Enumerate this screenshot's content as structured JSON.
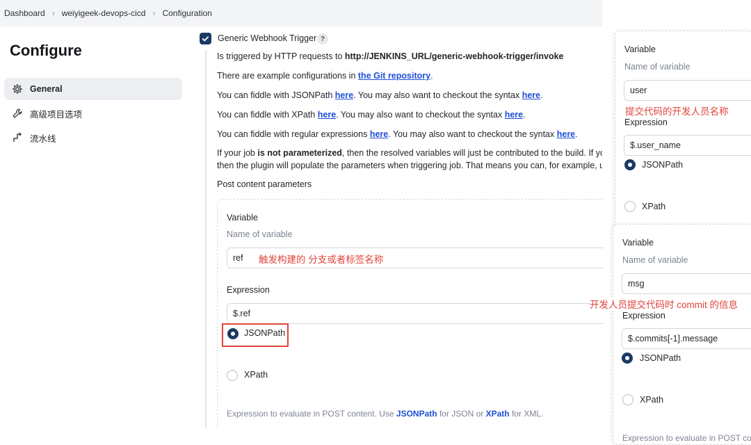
{
  "breadcrumb": {
    "items": [
      "Dashboard",
      "weiyigeek-devops-cicd",
      "Configuration"
    ]
  },
  "sidebar": {
    "title": "Configure",
    "items": [
      {
        "label": "General",
        "icon": "gear-icon"
      },
      {
        "label": "高级项目选项",
        "icon": "wrench-icon"
      },
      {
        "label": "流水线",
        "icon": "pipeline-icon"
      }
    ]
  },
  "trigger": {
    "label": "Generic Webhook Trigger",
    "help": "?",
    "p1_prefix": "Is triggered by HTTP requests to ",
    "p1_bold": "http://JENKINS_URL/generic-webhook-trigger/invoke",
    "p2_prefix": "There are example configurations in ",
    "p2_link": "the Git repository",
    "p2_suffix": ".",
    "p3_a": "You can fiddle with JSONPath ",
    "p3_link1": "here",
    "p3_b": ". You may also want to checkout the syntax ",
    "p3_link2": "here",
    "p3_c": ".",
    "p4_a": "You can fiddle with XPath ",
    "p4_link1": "here",
    "p4_b": ". You may also want to checkout the syntax ",
    "p4_link2": "here",
    "p4_c": ".",
    "p5_a": "You can fiddle with regular expressions ",
    "p5_link1": "here",
    "p5_b": ". You may also want to checkout the syntax ",
    "p5_link2": "here",
    "p5_c": ".",
    "p6_a": "If your job ",
    "p6_bold": "is not parameterized",
    "p6_b": ", then the resolved variables will just be contributed to the build. If your",
    "p7": "then the plugin will populate the parameters when triggering job. That means you can, for example, use",
    "post_params": "Post content parameters"
  },
  "main_var": {
    "variable_label": "Variable",
    "name_hint": "Name of variable",
    "name_value": "ref",
    "name_note": "触发构建的 分支或者标签名称",
    "expression_label": "Expression",
    "expression_value": "$.ref",
    "opt_jsonpath": "JSONPath",
    "opt_xpath": "XPath",
    "foot_a": "Expression to evaluate in POST content. Use ",
    "foot_link1": "JSONPath",
    "foot_b": " for JSON or ",
    "foot_link2": "XPath",
    "foot_c": " for XML."
  },
  "panel_user": {
    "variable_label": "Variable",
    "name_hint": "Name of variable",
    "name_value": "user",
    "name_note": "提交代码的开发人员名称",
    "expression_label": "Expression",
    "expression_value": "$.user_name",
    "opt_jsonpath": "JSONPath",
    "opt_xpath": "XPath"
  },
  "panel_msg": {
    "variable_label": "Variable",
    "name_hint": "Name of variable",
    "name_value": "msg",
    "name_note": "开发人员提交代码时 commit 的信息",
    "expression_label": "Expression",
    "expression_value": "$.commits[-1].message",
    "opt_jsonpath": "JSONPath",
    "opt_xpath": "XPath",
    "foot": "Expression to evaluate in POST con"
  },
  "colors": {
    "accent": "#1a3a64",
    "link": "#1d4ed8",
    "annotation": "#e0443a"
  }
}
